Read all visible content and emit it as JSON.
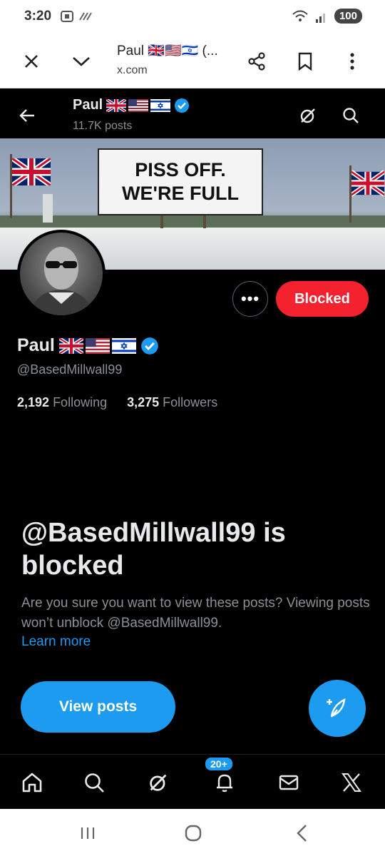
{
  "status_bar": {
    "time": "3:20",
    "battery": "100"
  },
  "browser": {
    "title": "Paul 🇬🇧🇺🇸🇮🇱 (...",
    "url": "x.com"
  },
  "profile": {
    "name": "Paul",
    "posts_count": "11.7K posts",
    "handle": "@BasedMillwall99",
    "following_count": "2,192",
    "following_label": "Following",
    "followers_count": "3,275",
    "followers_label": "Followers",
    "blocked_label": "Blocked",
    "more_label": "•••",
    "banner_sign_line1": "PISS OFF.",
    "banner_sign_line2": "WE'RE FULL"
  },
  "blocked_notice": {
    "title": "@BasedMillwall99 is blocked",
    "description": "Are you sure you want to view these posts? Viewing posts won’t unblock @BasedMillwall99.",
    "learn_more": "Learn more",
    "view_posts": "View posts"
  },
  "tabbar": {
    "notification_badge": "20+"
  },
  "colors": {
    "accent": "#1d9bf0",
    "blocked": "#f4212e",
    "background": "#000000"
  }
}
